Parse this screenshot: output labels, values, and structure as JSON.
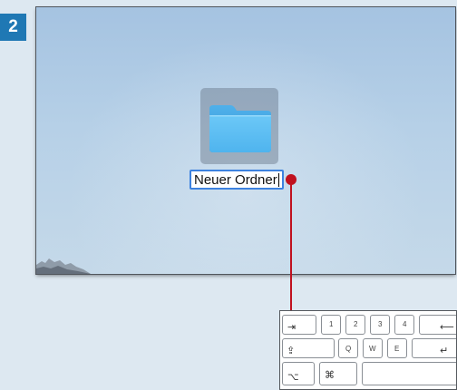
{
  "step": {
    "number": "2"
  },
  "desktop": {
    "folder": {
      "icon": "folder-icon",
      "name": "Neuer Ordner"
    }
  },
  "keyboard": {
    "row1": [
      {
        "name": "tab",
        "glyph": "⇥"
      },
      {
        "name": "1",
        "label": "1"
      },
      {
        "name": "2",
        "label": "2"
      },
      {
        "name": "3",
        "label": "3"
      },
      {
        "name": "4",
        "label": "4"
      },
      {
        "name": "backspace",
        "glyph": "⟵"
      }
    ],
    "row2": [
      {
        "name": "capslock",
        "glyph": "⇪"
      },
      {
        "name": "q",
        "label": "Q"
      },
      {
        "name": "w",
        "label": "W"
      },
      {
        "name": "e",
        "label": "E"
      },
      {
        "name": "return",
        "glyph": "↵"
      }
    ],
    "row3": [
      {
        "name": "option",
        "glyph": "⌥"
      },
      {
        "name": "command",
        "glyph": "⌘"
      },
      {
        "name": "space",
        "label": ""
      }
    ]
  },
  "colors": {
    "badge": "#1f78b4",
    "callout": "#c0111f",
    "folder": "#5bbcf4",
    "selection": "#3d82e0"
  }
}
